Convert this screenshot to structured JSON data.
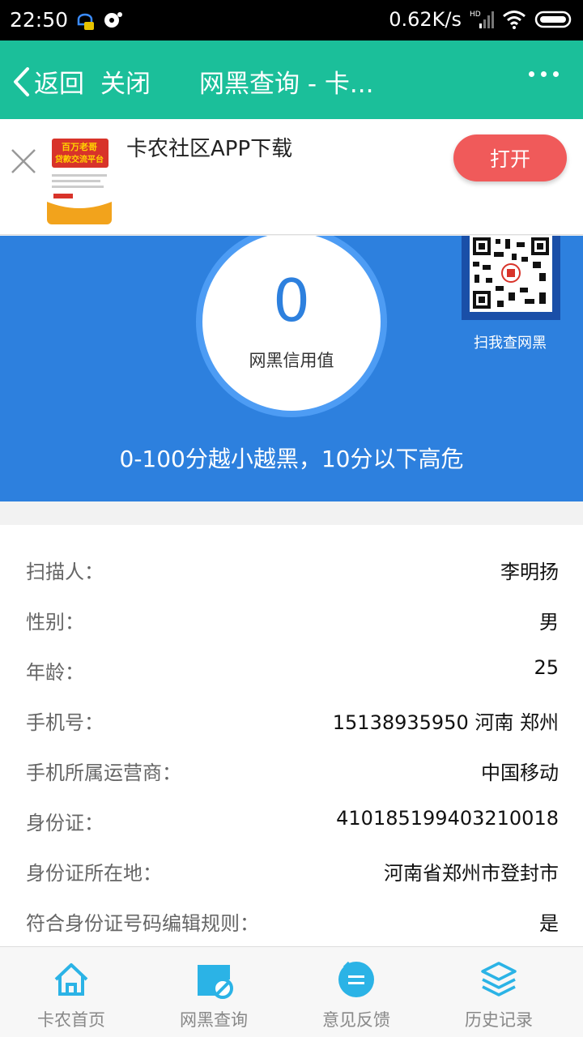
{
  "status_bar": {
    "time": "22:50",
    "network_speed": "0.62K/s",
    "signal_tag": "HD"
  },
  "nav": {
    "back_label": "返回",
    "close_label": "关闭",
    "title": "网黑查询 - 卡..."
  },
  "banner": {
    "title": "卡农社区APP下载",
    "open_label": "打开",
    "thumb_lines": [
      "百万老哥",
      "贷款交流平台"
    ]
  },
  "score": {
    "value": "0",
    "label": "网黑信用值",
    "qr_caption": "扫我查网黑",
    "note": "0-100分越小越黑，10分以下高危"
  },
  "info": {
    "rows": [
      {
        "key": "扫描人：",
        "value": "李明扬"
      },
      {
        "key": "性别：",
        "value": "男"
      },
      {
        "key": "年龄：",
        "value": "25"
      },
      {
        "key": "手机号：",
        "value": "15138935950 河南 郑州"
      },
      {
        "key": "手机所属运营商：",
        "value": "中国移动"
      },
      {
        "key": "身份证：",
        "value": "410185199403210018"
      },
      {
        "key": "身份证所在地：",
        "value": "河南省郑州市登封市"
      },
      {
        "key": "符合身份证号码编辑规则：",
        "value": "是"
      }
    ]
  },
  "tabs": [
    {
      "label": "卡农首页",
      "icon": "home-icon"
    },
    {
      "label": "网黑查询",
      "icon": "blacklist-query-icon"
    },
    {
      "label": "意见反馈",
      "icon": "feedback-icon"
    },
    {
      "label": "历史记录",
      "icon": "history-icon"
    }
  ],
  "colors": {
    "nav_bg": "#1bbf9a",
    "score_bg": "#2d80de",
    "open_button": "#f05a5a",
    "tab_icon": "#2bb3e6"
  }
}
